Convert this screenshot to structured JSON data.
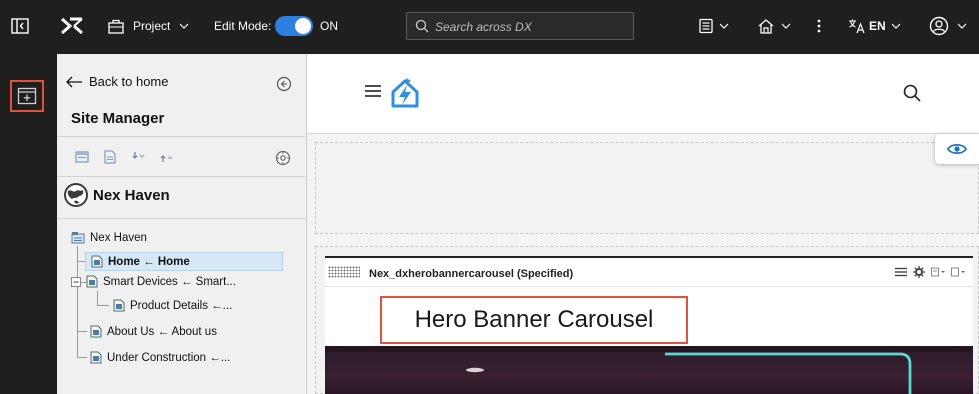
{
  "topbar": {
    "project_label": "Project",
    "edit_mode_label": "Edit Mode:",
    "edit_mode_state": "ON",
    "search_placeholder": "Search across DX",
    "language_label": "EN"
  },
  "site_manager": {
    "back_label": "Back to home",
    "title": "Site Manager",
    "site_name": "Nex Haven",
    "tree": [
      {
        "label": "Nex Haven"
      },
      {
        "label": "Home ← Home"
      },
      {
        "label": "Smart Devices ← Smart..."
      },
      {
        "label": "Product Details ←..."
      },
      {
        "label": "About Us ← About us"
      },
      {
        "label": "Under Construction ←..."
      }
    ]
  },
  "main": {
    "portlet_title": "Nex_dxherobannercarousel (Specified)",
    "hero_label": "Hero Banner Carousel"
  },
  "colors": {
    "topbar_bg": "#1f1f1f",
    "toggle_on": "#2f7fe0",
    "highlight_border": "#e0523b",
    "brand_blue": "#2f8fe0",
    "selected_row": "#d6e7f5"
  }
}
